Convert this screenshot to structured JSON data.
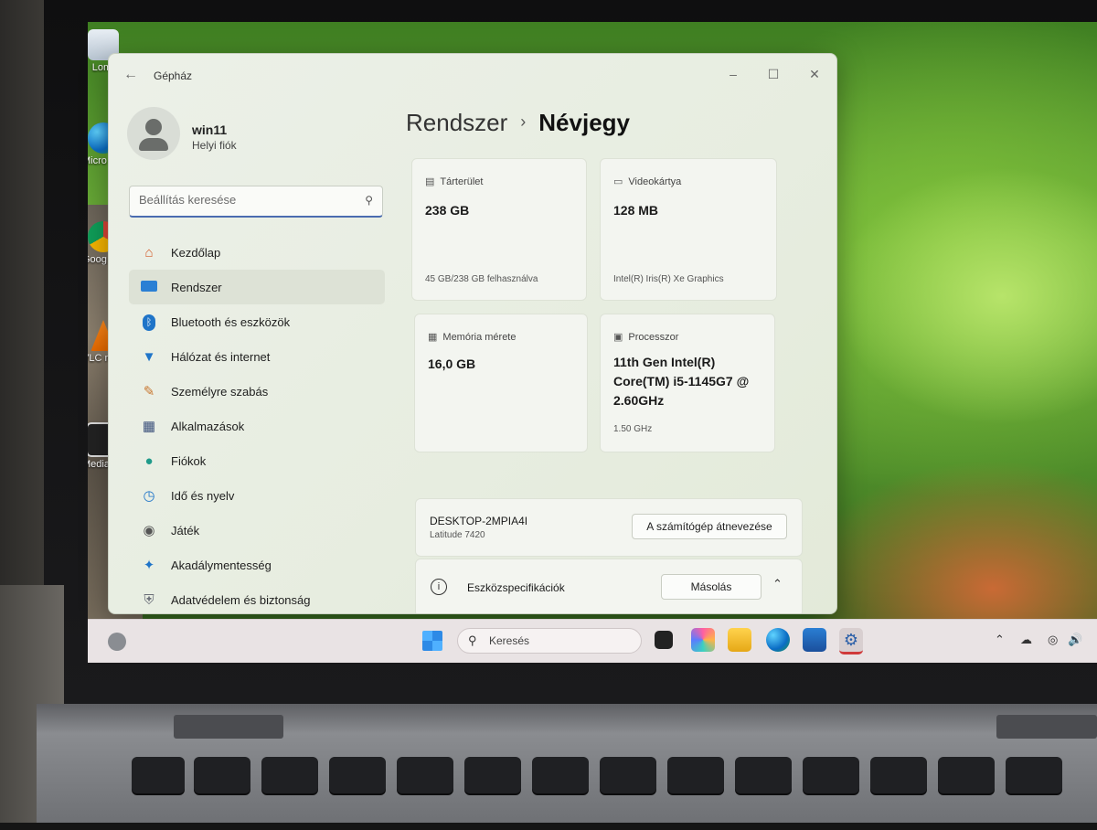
{
  "desktop": {
    "icons": [
      {
        "name": "recycle-bin",
        "label": "Lomt"
      },
      {
        "name": "edge",
        "label": "Micro Edg"
      },
      {
        "name": "chrome",
        "label": "Goog Chro"
      },
      {
        "name": "vlc",
        "label": "VLC m play"
      },
      {
        "name": "media-player",
        "label": "Media P Class"
      }
    ]
  },
  "window": {
    "title": "Gépház",
    "back_icon": "arrow-left-icon",
    "controls": {
      "minimize": "–",
      "maximize": "☐",
      "close": "✕"
    }
  },
  "profile": {
    "name": "win11",
    "subtitle": "Helyi fiók"
  },
  "search": {
    "placeholder": "Beállítás keresése"
  },
  "nav": [
    {
      "label": "Kezdőlap",
      "icon": "home-icon",
      "selected": false
    },
    {
      "label": "Rendszer",
      "icon": "monitor-icon",
      "selected": true
    },
    {
      "label": "Bluetooth és eszközök",
      "icon": "bluetooth-icon",
      "selected": false
    },
    {
      "label": "Hálózat és internet",
      "icon": "wifi-icon",
      "selected": false
    },
    {
      "label": "Személyre szabás",
      "icon": "brush-icon",
      "selected": false
    },
    {
      "label": "Alkalmazások",
      "icon": "apps-icon",
      "selected": false
    },
    {
      "label": "Fiókok",
      "icon": "person-icon",
      "selected": false
    },
    {
      "label": "Idő és nyelv",
      "icon": "globe-clock-icon",
      "selected": false
    },
    {
      "label": "Játék",
      "icon": "gamepad-icon",
      "selected": false
    },
    {
      "label": "Akadálymentesség",
      "icon": "accessibility-icon",
      "selected": false
    },
    {
      "label": "Adatvédelem és biztonság",
      "icon": "shield-icon",
      "selected": false
    }
  ],
  "breadcrumb": {
    "parent": "Rendszer",
    "separator": "›",
    "current": "Névjegy"
  },
  "cards": {
    "storage": {
      "title": "Tárterület",
      "value": "238 GB",
      "detail": "45 GB/238 GB felhasználva"
    },
    "gpu": {
      "title": "Videokártya",
      "value": "128 MB",
      "detail": "Intel(R) Iris(R) Xe Graphics"
    },
    "memory": {
      "title": "Memória mérete",
      "value": "16,0 GB",
      "detail": ""
    },
    "cpu": {
      "title": "Processzor",
      "value_lines": [
        "11th Gen Intel(R)",
        "Core(TM) i5-1145G7 @",
        "2.60GHz"
      ],
      "detail": "1.50 GHz"
    }
  },
  "device": {
    "name": "DESKTOP-2MPIA4I",
    "model": "Latitude 7420",
    "rename_label": "A számítógép átnevezése"
  },
  "specs": {
    "label": "Eszközspecifikációk",
    "copy_label": "Másolás",
    "expand_icon": "chevron-up-icon"
  },
  "taskbar": {
    "search_label": "Keresés",
    "apps": [
      "start-icon",
      "task-view-icon",
      "copilot-icon",
      "file-explorer-icon",
      "edge-icon",
      "store-icon",
      "settings-icon"
    ]
  }
}
